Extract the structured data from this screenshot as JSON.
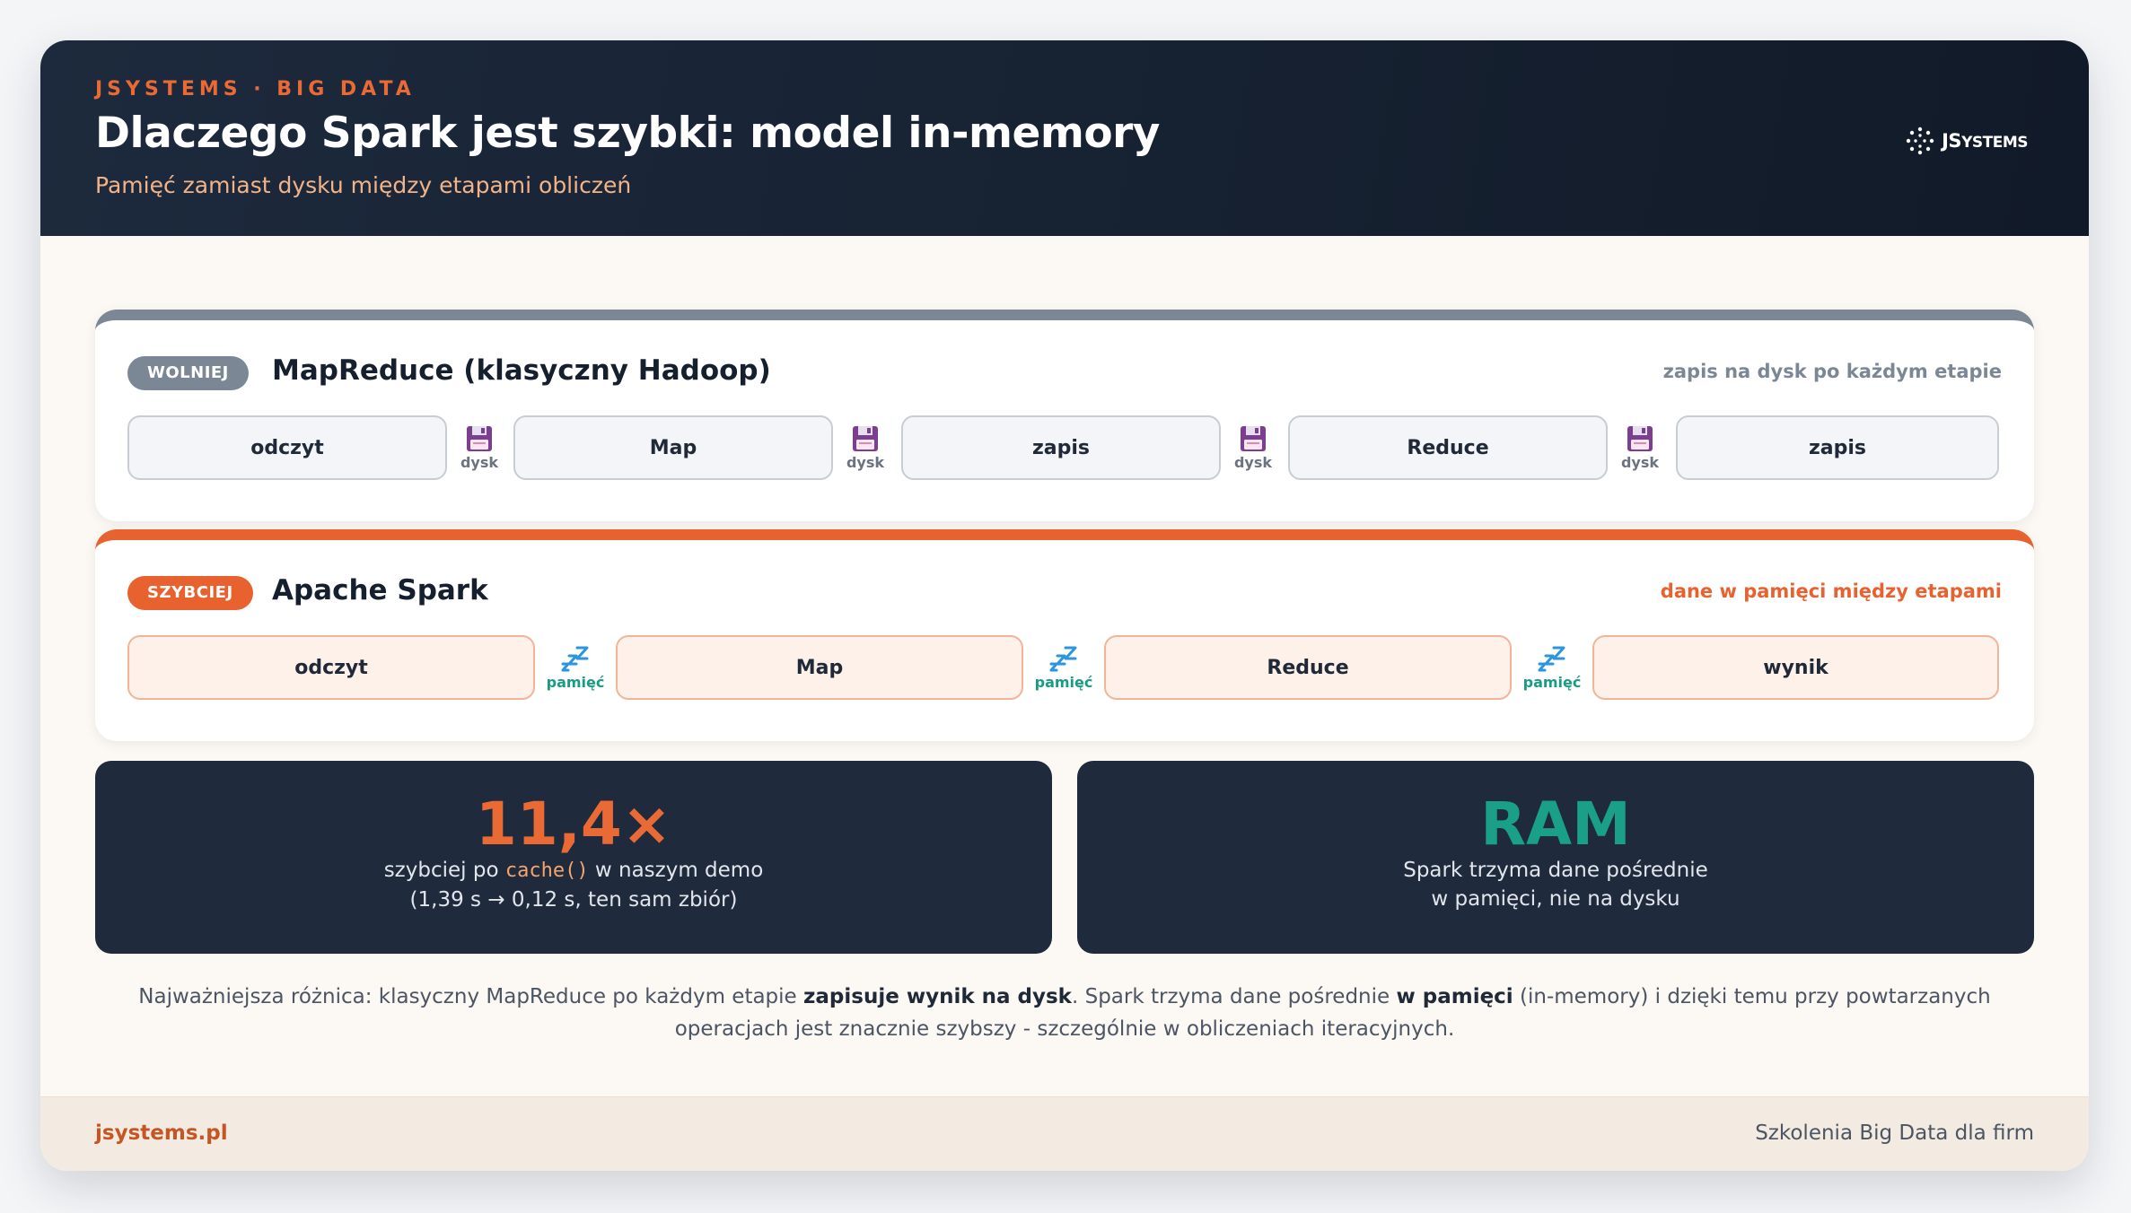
{
  "header": {
    "eyebrow": "JSYSTEMS · BIG DATA",
    "title": "Dlaczego Spark jest szybki: model in-memory",
    "subtitle": "Pamięć zamiast dysku między etapami obliczeń",
    "logo_text_main": "JS",
    "logo_text_rest": "YSTEMS"
  },
  "mapreduce": {
    "badge": "WOLNIEJ",
    "title": "MapReduce (klasyczny Hadoop)",
    "note": "zapis na dysk po każdym etapie",
    "steps": [
      "odczyt",
      "Map",
      "zapis",
      "Reduce",
      "zapis"
    ],
    "connector_label": "dysk",
    "connector_icon": "floppy-disk-icon"
  },
  "spark": {
    "badge": "SZYBCIEJ",
    "title": "Apache Spark",
    "note": "dane w pamięci między etapami",
    "steps": [
      "odczyt",
      "Map",
      "Reduce",
      "wynik"
    ],
    "connector_label": "pamięć",
    "connector_icon": "zzz-icon"
  },
  "stats": {
    "speedup": {
      "value": "11,4×",
      "line1_before": "szybciej po ",
      "line1_code": "cache()",
      "line1_after": " w naszym demo",
      "line2": "(1,39 s → 0,12 s, ten sam zbiór)"
    },
    "ram": {
      "value": "RAM",
      "line1": "Spark trzyma dane pośrednie",
      "line2": "w pamięci, nie na dysku"
    }
  },
  "summary": {
    "part1": "Najważniejsza różnica: klasyczny MapReduce po każdym etapie ",
    "bold1": "zapisuje wynik na dysk",
    "part2": ". Spark trzyma dane pośrednie ",
    "bold2": "w pamięci",
    "part3": " (in-memory) i dzięki temu przy powtarzanych operacjach jest znacznie szybszy - szczególnie w obliczeniach iteracyjnych."
  },
  "footer": {
    "site": "jsystems.pl",
    "tagline": "Szkolenia Big Data dla firm"
  },
  "colors": {
    "accent_orange": "#e8622f",
    "slate": "#7c8796",
    "teal": "#1aa088",
    "navy": "#1f2a3c"
  }
}
